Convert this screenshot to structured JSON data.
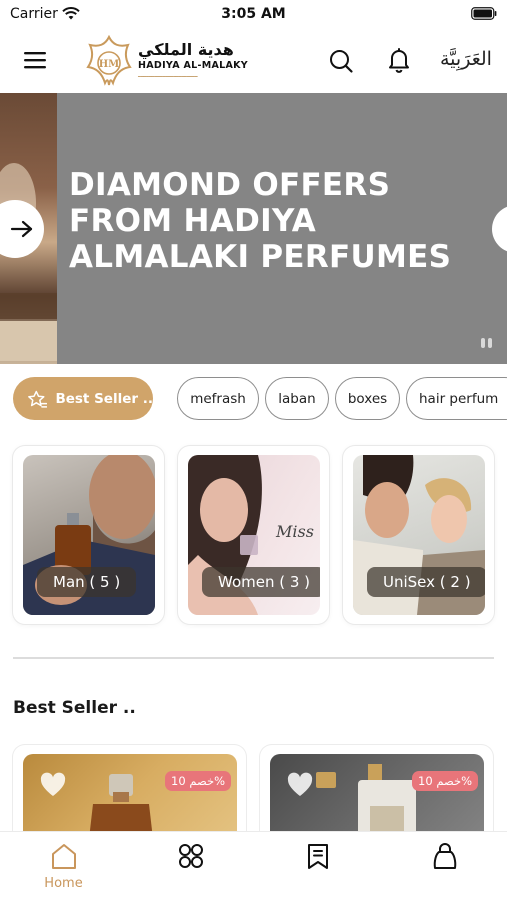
{
  "status_bar": {
    "carrier": "Carrier",
    "time": "3:05 AM"
  },
  "header": {
    "logo_arabic": "هدية الملكي",
    "logo_english": "HADIYA AL-MALAKY",
    "logo_monogram": "HM",
    "language_button": "العَرَبِيَّة",
    "icons": [
      "menu-icon",
      "search-icon",
      "bell-icon"
    ]
  },
  "banner": {
    "title": "DIAMOND OFFERS FROM HADIYA ALMALAKI PERFUMES",
    "icons": [
      "arrow-right-icon"
    ],
    "bg_color": "#858585"
  },
  "filters": {
    "active": "Best Seller ..",
    "items": [
      "mefrash",
      "laban",
      "boxes",
      "hair perfum"
    ]
  },
  "categories": [
    {
      "label": "Man  ( 5 )"
    },
    {
      "label": "Women  ( 3 )"
    },
    {
      "label": "UniSex  ( 2 )"
    }
  ],
  "section": {
    "title": "Best Seller .."
  },
  "products": [
    {
      "discount": "خصم 10%"
    },
    {
      "discount": "خصم 10%"
    }
  ],
  "tab_bar": {
    "active_index": 0,
    "items": [
      {
        "label": "Home",
        "icon": "home-icon"
      },
      {
        "label": "",
        "icon": "grid-icon"
      },
      {
        "label": "",
        "icon": "bookmark-icon"
      },
      {
        "label": "",
        "icon": "bag-icon"
      }
    ]
  },
  "colors": {
    "accent": "#d0a46a",
    "tab_active": "#c9965c",
    "discount_badge": "#e8757a"
  }
}
